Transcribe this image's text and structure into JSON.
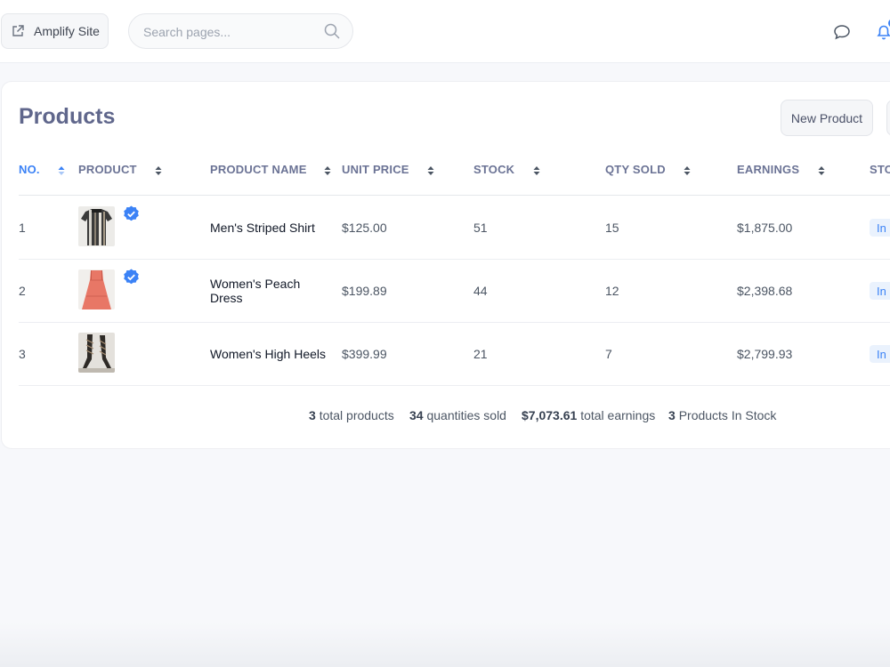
{
  "header": {
    "site_button": "Amplify Site",
    "search_placeholder": "Search pages...",
    "notification_count": ""
  },
  "page": {
    "title": "Products",
    "new_product_label": "New Product"
  },
  "table": {
    "columns": [
      "NO.",
      "PRODUCT",
      "PRODUCT NAME",
      "UNIT PRICE",
      "STOCK",
      "QTY SOLD",
      "EARNINGS",
      "STOC"
    ],
    "rows": [
      {
        "no": "1",
        "name": "Men's Striped Shirt",
        "price": "$125.00",
        "stock": "51",
        "qty_sold": "15",
        "earnings": "$1,875.00",
        "status": "In",
        "verified": true,
        "image": "striped-shirt-photo"
      },
      {
        "no": "2",
        "name": "Women's Peach Dress",
        "price": "$199.89",
        "stock": "44",
        "qty_sold": "12",
        "earnings": "$2,398.68",
        "status": "In",
        "verified": true,
        "image": "peach-dress-photo"
      },
      {
        "no": "3",
        "name": "Women's High Heels",
        "price": "$399.99",
        "stock": "21",
        "qty_sold": "7",
        "earnings": "$2,799.93",
        "status": "In",
        "verified": false,
        "image": "high-heels-photo"
      }
    ]
  },
  "summary": {
    "total_products_value": "3",
    "total_products_label": "total products",
    "qty_sold_value": "34",
    "qty_sold_label": "quantities sold",
    "earnings_value": "$7,073.61",
    "earnings_label": "total earnings",
    "in_stock_value": "3",
    "in_stock_label": "Products In Stock"
  },
  "colors": {
    "accent": "#3b82f6",
    "title": "#60678c",
    "badge_bg": "#eaf2fd"
  }
}
